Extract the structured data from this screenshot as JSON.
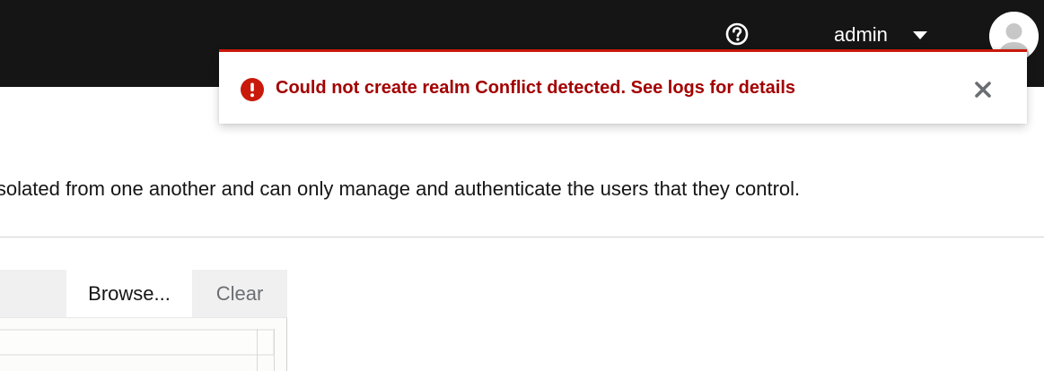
{
  "header": {
    "help_icon": "question-circle-icon",
    "username": "admin",
    "caret_icon": "caret-down-icon",
    "avatar_icon": "user-avatar-icon",
    "background_color": "#151515"
  },
  "alert": {
    "variant": "danger",
    "icon": "exclamation-circle-icon",
    "title": "Could not create realm Conflict detected. See logs for details",
    "close_icon": "close-icon",
    "accent_color": "#c9190b",
    "text_color": "#a30000"
  },
  "page": {
    "description": "isolated from one another and can only manage and authenticate the users that they control."
  },
  "file_upload": {
    "browse_label": "Browse...",
    "clear_label": "Clear",
    "filename_value": "",
    "content_value": ""
  }
}
